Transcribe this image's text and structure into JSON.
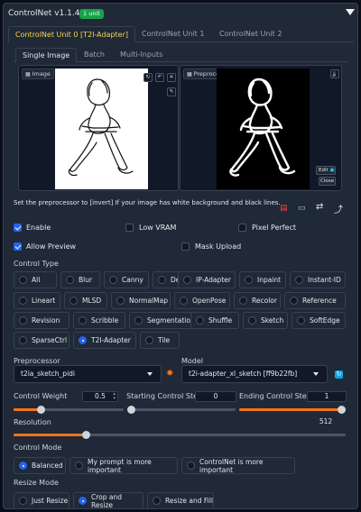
{
  "header": {
    "title": "ControlNet v1.1.444",
    "badge": "1 unit"
  },
  "unit_tabs": [
    "ControlNet Unit 0 [T2I-Adapter]",
    "ControlNet Unit 1",
    "ControlNet Unit 2"
  ],
  "image_tabs": [
    "Single Image",
    "Batch",
    "Multi-Inputs"
  ],
  "image_panel": {
    "label": "Image"
  },
  "preview_panel": {
    "label": "Preprocessor Preview",
    "edit_label": "Edit",
    "close_label": "Close"
  },
  "hint": "Set the preprocessor to [invert] If your image has white background and black lines.",
  "checkboxes": {
    "enable": {
      "label": "Enable",
      "checked": true
    },
    "low_vram": {
      "label": "Low VRAM",
      "checked": false
    },
    "pixel_perfect": {
      "label": "Pixel Perfect",
      "checked": false
    },
    "allow_preview": {
      "label": "Allow Preview",
      "checked": true
    },
    "mask_upload": {
      "label": "Mask Upload",
      "checked": false
    }
  },
  "control_type": {
    "label": "Control Type",
    "selected": "T2I-Adapter",
    "options": [
      "All",
      "Blur",
      "Canny",
      "Depth",
      "IP-Adapter",
      "Inpaint",
      "Instant-ID",
      "Lineart",
      "MLSD",
      "NormalMap",
      "OpenPose",
      "Recolor",
      "Reference",
      "Revision",
      "Scribble",
      "Segmentation",
      "Shuffle",
      "Sketch",
      "SoftEdge",
      "SparseCtrl",
      "T2I-Adapter",
      "Tile"
    ]
  },
  "preprocessor": {
    "label": "Preprocessor",
    "value": "t2ia_sketch_pidi"
  },
  "model": {
    "label": "Model",
    "value": "t2i-adapter_xl_sketch [ff9b22fb]"
  },
  "control_weight": {
    "label": "Control Weight",
    "value": "0.5",
    "fraction": 0.25
  },
  "start_step": {
    "label": "Starting Control Step",
    "value": "0",
    "fraction": 0.0
  },
  "end_step": {
    "label": "Ending Control Step",
    "value": "1",
    "fraction": 1.0
  },
  "resolution": {
    "label": "Resolution",
    "value": "512",
    "fraction": 0.22
  },
  "control_mode": {
    "label": "Control Mode",
    "selected": "Balanced",
    "options": [
      "Balanced",
      "My prompt is more important",
      "ControlNet is more important"
    ]
  },
  "resize_mode": {
    "label": "Resize Mode",
    "selected": "Crop and Resize",
    "options": [
      "Just Resize",
      "Crop and Resize",
      "Resize and Fill"
    ]
  },
  "colors": {
    "accent": "#2563eb",
    "slider": "#f97316",
    "badge": "#16a34a",
    "active_tab": "#fcd34d"
  }
}
